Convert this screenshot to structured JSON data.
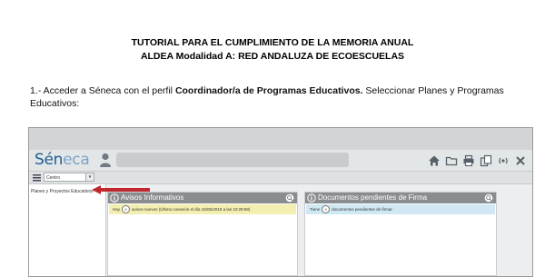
{
  "document": {
    "title_line1": "TUTORIAL PARA EL CUMPLIMIENTO DE LA MEMORIA ANUAL",
    "title_line2": "ALDEA Modalidad A: RED ANDALUZA DE ECOESCUELAS",
    "step_prefix": "1.- Acceder a Séneca con el perfil ",
    "step_bold": "Coordinador/a de Programas Educativos.",
    "step_suffix": " Seleccionar Planes y Programas Educativos:"
  },
  "seneca": {
    "logo_main": "Sén",
    "logo_accent": "eca",
    "toolbar_icons": [
      "home-icon",
      "folder-icon",
      "print-icon",
      "copy-icon",
      "broadcast-icon",
      "close-icon"
    ],
    "centro_select": "Centro",
    "sidebar_item": "Planes y Proyectos Educativos",
    "panels": [
      {
        "title": "Avisos Informativos",
        "row_prefix": "Hay",
        "row_count": "0",
        "row_text": "avisos nuevos (Última conexión el día 15/05/2018 a las 10:28:58)",
        "row_bg": "#f3efb0",
        "head_color": "#8e8f86"
      },
      {
        "title": "Documentos pendientes de Firma",
        "row_prefix": "Tiene",
        "row_count": "0",
        "row_text": "documentos pendientes de firmar",
        "row_bg": "#cfe8f3",
        "head_color": "#8a8d90"
      }
    ],
    "arrow_color": "#c0282d"
  }
}
